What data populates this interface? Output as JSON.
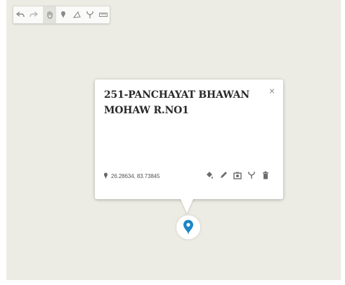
{
  "toolbar": {
    "tools": [
      {
        "icon": "undo-icon"
      },
      {
        "icon": "redo-icon"
      },
      {
        "icon": "hand-icon",
        "active": true
      },
      {
        "icon": "pin-icon"
      },
      {
        "icon": "draw-line-icon"
      },
      {
        "icon": "route-icon"
      },
      {
        "icon": "measure-icon"
      }
    ]
  },
  "popup": {
    "title": "251-PANCHAYAT BHAWAN MOHAW R.NO1",
    "close_label": "×",
    "coordinates": "26.28634, 83.73845",
    "actions": [
      "paint-bucket-icon",
      "pencil-icon",
      "camera-icon",
      "route-icon",
      "trash-icon"
    ]
  },
  "colors": {
    "map_background": "#ecebe4",
    "marker_blue": "#1c86c8",
    "text_dark": "#2a2a2a",
    "icon_gray": "#7a7a7a"
  }
}
